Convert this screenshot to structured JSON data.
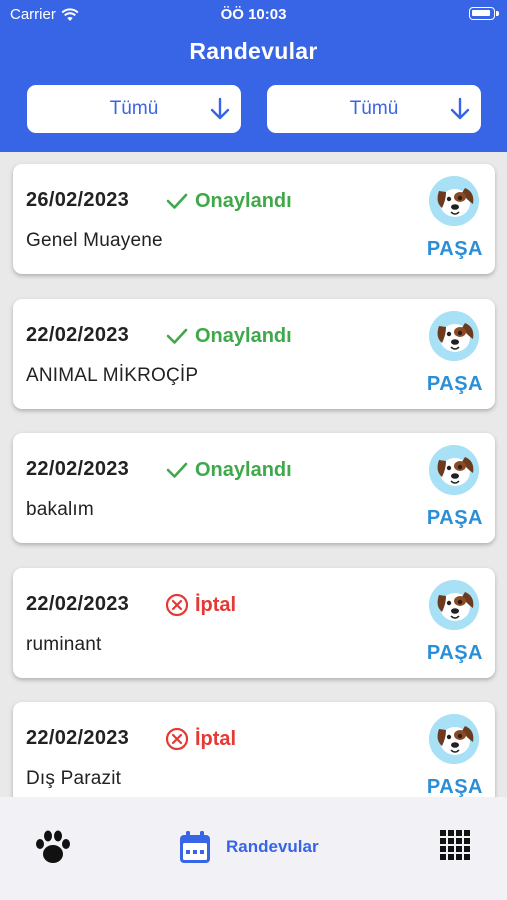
{
  "status_bar": {
    "carrier": "Carrier",
    "time": "ÖÖ 10:03"
  },
  "header": {
    "title": "Randevular"
  },
  "filters": {
    "left": "Tümü",
    "right": "Tümü"
  },
  "appointments": [
    {
      "date": "26/02/2023",
      "status": "Onaylandı",
      "status_type": "approved",
      "service": "Genel Muayene",
      "pet": "PAŞA"
    },
    {
      "date": "22/02/2023",
      "status": "Onaylandı",
      "status_type": "approved",
      "service": "ANIMAL MİKROÇİP",
      "pet": "PAŞA"
    },
    {
      "date": "22/02/2023",
      "status": "Onaylandı",
      "status_type": "approved",
      "service": "bakalım",
      "pet": "PAŞA"
    },
    {
      "date": "22/02/2023",
      "status": "İptal",
      "status_type": "cancelled",
      "service": "ruminant",
      "pet": "PAŞA"
    },
    {
      "date": "22/02/2023",
      "status": "İptal",
      "status_type": "cancelled",
      "service": "Dış Parazit",
      "pet": "PAŞA"
    }
  ],
  "bottom_nav": {
    "items": [
      {
        "icon": "paw-icon"
      },
      {
        "icon": "calendar-icon",
        "label": "Randevular"
      },
      {
        "icon": "grid-icon"
      }
    ]
  },
  "colors": {
    "primary": "#3865e6",
    "approved": "#3fa84a",
    "cancelled": "#e53935",
    "pet_name": "#2b8fd8"
  }
}
